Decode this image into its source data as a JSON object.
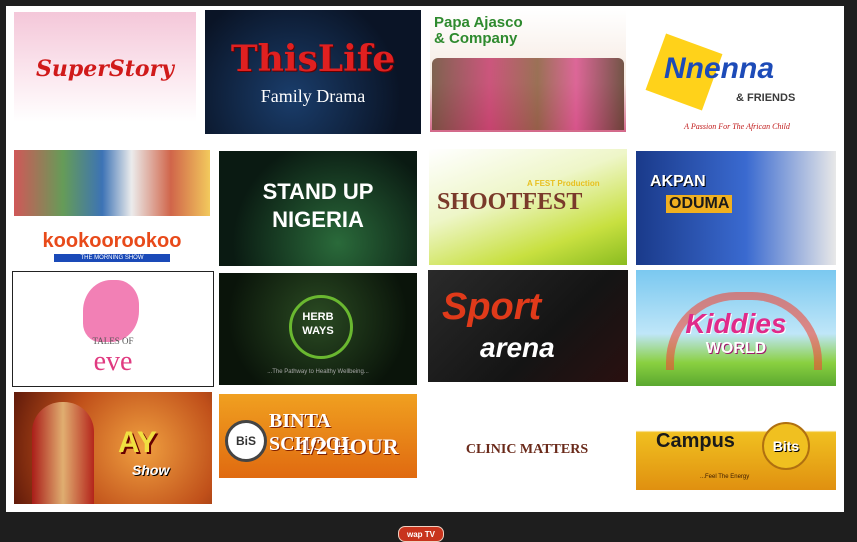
{
  "tiles": [
    {
      "title": "SuperStory"
    },
    {
      "title": "ThisLife",
      "subtitle": "Family Drama"
    },
    {
      "title": "Papa Ajasco",
      "subtitle": "& Company"
    },
    {
      "title": "Nnenna",
      "subtitle": "& FRIENDS",
      "tagline": "A Passion For The African Child"
    },
    {
      "title": "kookoorookoo",
      "subtitle": "THE MORNING SHOW"
    },
    {
      "title": "STAND UP",
      "subtitle": "NIGERIA"
    },
    {
      "title": "SHOOTFEST",
      "subtitle": "A FEST Production"
    },
    {
      "title": "AKPAN",
      "subtitle": "ODUMA"
    },
    {
      "title": "TALES OF",
      "subtitle": "eve"
    },
    {
      "title": "HERB",
      "subtitle": "WAYS",
      "tagline": "...The Pathway to Healthy Wellbeing..."
    },
    {
      "title": "Sport",
      "subtitle": "arena"
    },
    {
      "title": "Kiddies",
      "subtitle": "WORLD"
    },
    {
      "title": "AY",
      "subtitle": "Show"
    },
    {
      "title": "BINTA SCHOOL",
      "subtitle": "1/2 HOUR",
      "badge": "BiS"
    },
    {
      "title": "CLINIC MATTERS"
    },
    {
      "title": "Campus",
      "subtitle": "Bits",
      "tagline": "...Feel The Energy"
    }
  ],
  "footer": {
    "logo": "wap TV"
  }
}
